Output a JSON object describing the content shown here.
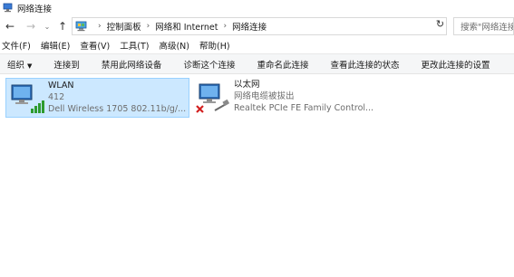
{
  "window": {
    "title": "网络连接"
  },
  "nav": {
    "back_icon": "back-arrow-icon",
    "forward_icon": "forward-arrow-icon",
    "recent_icon": "chevron-down-icon",
    "up_icon": "up-arrow-icon"
  },
  "address": {
    "crumbs": [
      "控制面板",
      "网络和 Internet",
      "网络连接"
    ],
    "separator": "›"
  },
  "search": {
    "placeholder": "搜索\"网络连接\""
  },
  "menu": [
    "文件(F)",
    "编辑(E)",
    "查看(V)",
    "工具(T)",
    "高级(N)",
    "帮助(H)"
  ],
  "toolbar": {
    "organize": "组织",
    "items": [
      "连接到",
      "禁用此网络设备",
      "诊断这个连接",
      "重命名此连接",
      "查看此连接的状态",
      "更改此连接的设置"
    ]
  },
  "connections": [
    {
      "name": "WLAN",
      "status": "412",
      "device": "Dell Wireless 1705 802.11b/g/...",
      "selected": true,
      "type": "wireless"
    },
    {
      "name": "以太网",
      "status": "网络电缆被拔出",
      "device": "Realtek PCIe FE Family Control...",
      "selected": false,
      "type": "ethernet-disconnected"
    }
  ],
  "colors": {
    "selection_bg": "#cce8ff",
    "selection_border": "#99d1ff",
    "toolbar_bg": "#f5f6f7",
    "signal_green": "#2e9b2e",
    "error_red": "#d32020"
  }
}
